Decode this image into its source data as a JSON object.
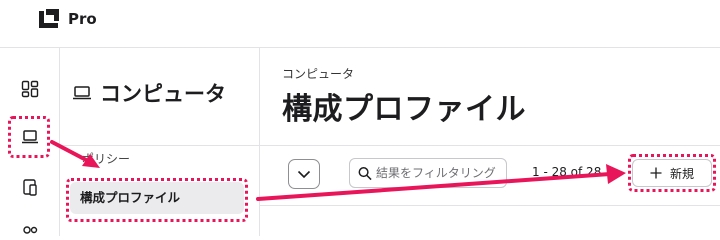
{
  "app": {
    "brand": "Pro"
  },
  "rail": {
    "items": [
      {
        "icon": "grid-icon"
      },
      {
        "icon": "laptop-icon"
      },
      {
        "icon": "devices-icon"
      },
      {
        "icon": "users-icon"
      }
    ]
  },
  "sidebar": {
    "title": "コンピュータ",
    "section": "ポリシー",
    "selected_item": "構成プロファイル"
  },
  "main": {
    "breadcrumb": "コンピュータ",
    "title": "構成プロファイル",
    "search_placeholder": "結果をフィルタリング",
    "pager": "1 - 28 of 28",
    "new_button": "新規"
  },
  "colors": {
    "highlight": "#e8155a",
    "selected_bg": "#ebebed",
    "border": "#e3e3e6"
  }
}
